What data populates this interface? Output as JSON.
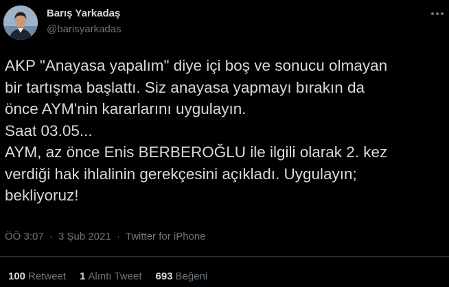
{
  "author": {
    "display_name": "Barış Yarkadaş",
    "handle": "@barisyarkadas"
  },
  "tweet": {
    "text": "AKP \"Anayasa yapalım\" diye içi boş ve sonucu olmayan\nbir tartışma başlattı. Siz anayasa yapmayı bırakın da\nönce AYM'nin kararlarını uygulayın.\nSaat 03.05...\nAYM, az önce Enis BERBEROĞLU ile ilgili olarak 2. kez\nverdiği hak ihlalinin gerekçesini açıkladı. Uygulayın;\nbekliyoruz!"
  },
  "meta": {
    "time": "ÖÖ 3:07",
    "date": "3 Şub 2021",
    "separator": "·",
    "source": "Twitter for iPhone"
  },
  "stats": {
    "retweets": {
      "count": "100",
      "label": "Retweet"
    },
    "quotes": {
      "count": "1",
      "label": "Alıntı Tweet"
    },
    "likes": {
      "count": "693",
      "label": "Beğeni"
    }
  },
  "icons": {
    "more": "more-horizontal-icon"
  },
  "colors": {
    "background": "#000000",
    "text_primary": "#d9d9d9",
    "text_secondary": "#6e767d",
    "divider": "#2f3336"
  }
}
